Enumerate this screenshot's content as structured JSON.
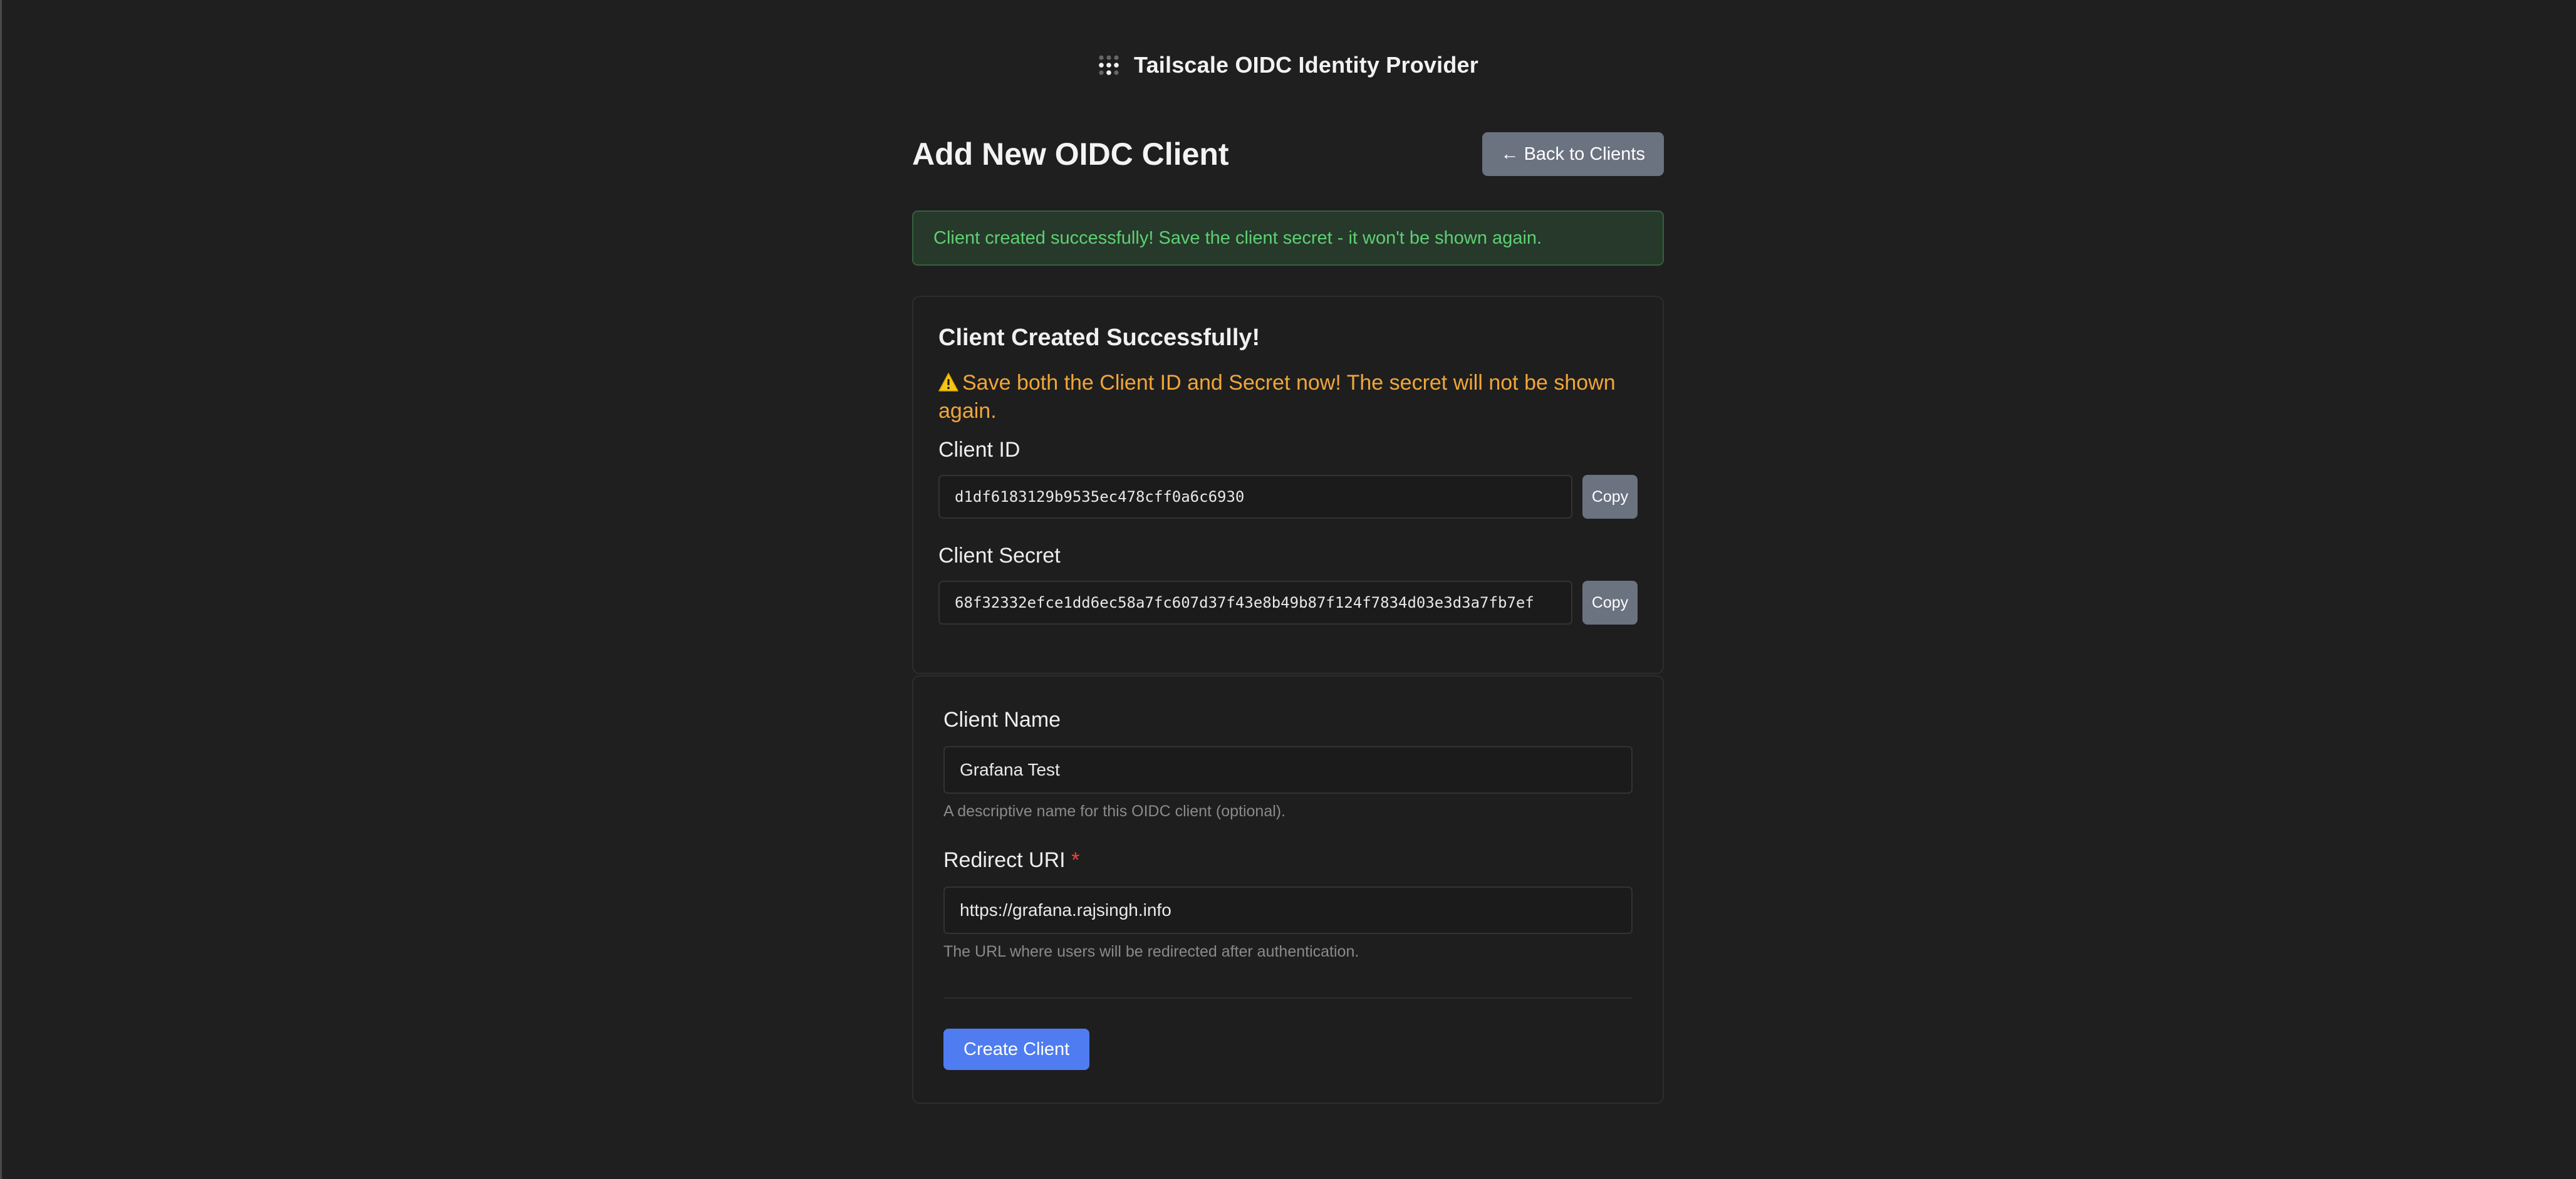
{
  "header": {
    "logo_icon": "tailscale-dots-icon",
    "title": "Tailscale OIDC Identity Provider"
  },
  "page": {
    "title": "Add New OIDC Client",
    "back_button_label": "← Back to Clients"
  },
  "alert": {
    "message": "Client created successfully! Save the client secret - it won't be shown again."
  },
  "credentials": {
    "heading": "Client Created Successfully!",
    "warning_icon": "warning-icon",
    "warning_text": "Save both the Client ID and Secret now! The secret will not be shown again.",
    "client_id_label": "Client ID",
    "client_id_value": "d1df6183129b9535ec478cff0a6c6930",
    "client_secret_label": "Client Secret",
    "client_secret_value": "68f32332efce1dd6ec58a7fc607d37f43e8b49b87f124f7834d03e3d3a7fb7ef",
    "copy_label": "Copy"
  },
  "form": {
    "client_name_label": "Client Name",
    "client_name_value": "Grafana Test",
    "client_name_help": "A descriptive name for this OIDC client (optional).",
    "redirect_uri_label": "Redirect URI",
    "required_mark": "*",
    "redirect_uri_value": "https://grafana.rajsingh.info",
    "redirect_uri_help": "The URL where users will be redirected after authentication.",
    "submit_label": "Create Client"
  },
  "colors": {
    "background": "#1f1f1f",
    "success_text": "#5fcf73",
    "warning_text": "#f0a63a",
    "primary_button": "#4f7cf0",
    "secondary_button": "#6b7280",
    "required": "#ef4444"
  }
}
